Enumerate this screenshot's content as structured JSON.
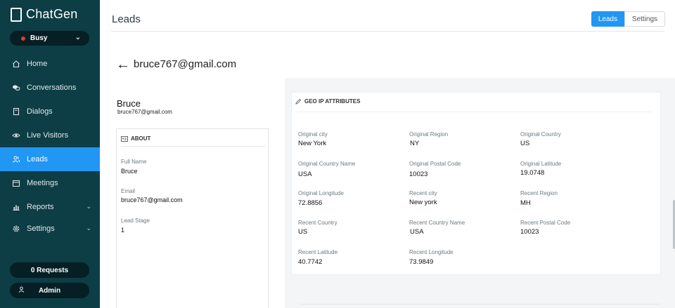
{
  "brand": {
    "name": "ChatGen"
  },
  "status": {
    "label": "Busy",
    "color": "#e53935"
  },
  "nav": [
    {
      "label": "Home",
      "icon": "home-icon"
    },
    {
      "label": "Conversations",
      "icon": "chat-icon"
    },
    {
      "label": "Dialogs",
      "icon": "document-icon"
    },
    {
      "label": "Live Visitors",
      "icon": "eye-icon"
    },
    {
      "label": "Leads",
      "icon": "users-icon",
      "active": true
    },
    {
      "label": "Meetings",
      "icon": "calendar-icon"
    },
    {
      "label": "Reports",
      "icon": "bar-chart-icon",
      "has_submenu": true
    },
    {
      "label": "Settings",
      "icon": "gear-icon",
      "has_submenu": true
    }
  ],
  "sidebar_footer": {
    "requests": "0 Requests",
    "user": "Admin"
  },
  "header": {
    "title": "Leads",
    "toggle": [
      "Leads",
      "Settings"
    ],
    "active_toggle": "Leads"
  },
  "lead": {
    "email_title": "bruce767@gmail.com",
    "name": "Bruce",
    "email": "bruce767@gmail.com"
  },
  "about": {
    "heading": "ABOUT",
    "fields": [
      {
        "label": "Full Name",
        "value": "Bruce"
      },
      {
        "label": "Email",
        "value": "bruce767@gmail.com"
      },
      {
        "label": "Lead Stage",
        "value": "1"
      }
    ]
  },
  "geo": {
    "heading": "GEO IP ATTRIBUTES",
    "attributes": [
      {
        "label": "Original city",
        "value": "New York"
      },
      {
        "label": "Original Region",
        "value": "NY"
      },
      {
        "label": "Original Country",
        "value": "US"
      },
      {
        "label": "Original Country Name",
        "value": "USA"
      },
      {
        "label": "Original Postal Code",
        "value": "10023"
      },
      {
        "label": "Original Latitude",
        "value": "19.0748"
      },
      {
        "label": "Original Longitude",
        "value": "72.8856"
      },
      {
        "label": "Recent city",
        "value": "New york"
      },
      {
        "label": "Recent Region",
        "value": "MH"
      },
      {
        "label": "Recent Country",
        "value": "US"
      },
      {
        "label": "Recent Country Name",
        "value": "USA"
      },
      {
        "label": "Recent Postal Code",
        "value": "10023"
      },
      {
        "label": "Recent Latitude",
        "value": "40.7742"
      },
      {
        "label": "Recent Longitude",
        "value": "73.9849"
      }
    ]
  },
  "colors": {
    "sidebar": "#0d3d45",
    "accent": "#2196f3"
  }
}
